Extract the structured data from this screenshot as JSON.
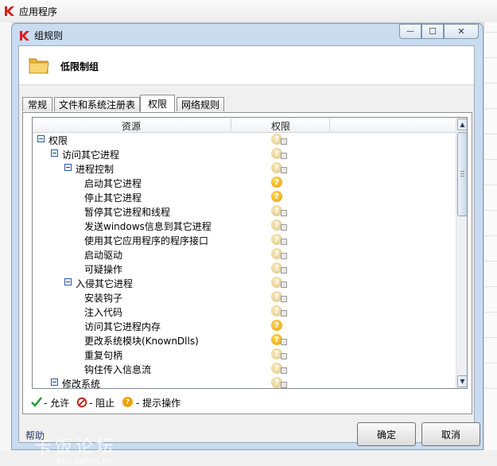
{
  "parent_window": {
    "title": "应用程序"
  },
  "dialog": {
    "title": "组规则",
    "controls": {
      "minimize": "—",
      "maximize": "☐",
      "close": "✕"
    }
  },
  "group": {
    "name": "低限制组"
  },
  "tabs": [
    {
      "label": "常规",
      "active": false
    },
    {
      "label": "文件和系统注册表",
      "active": false
    },
    {
      "label": "权限",
      "active": true
    },
    {
      "label": "网络规则",
      "active": false
    }
  ],
  "tree": {
    "columns": [
      "资源",
      "权限"
    ],
    "rows": [
      {
        "label": "权限",
        "level": 0,
        "expandable": true,
        "perm": "prompt-inherited"
      },
      {
        "label": "访问其它进程",
        "level": 1,
        "expandable": true,
        "perm": "prompt-inherited"
      },
      {
        "label": "进程控制",
        "level": 2,
        "expandable": true,
        "perm": "prompt-inherited"
      },
      {
        "label": "启动其它进程",
        "level": 3,
        "expandable": false,
        "perm": "prompt"
      },
      {
        "label": "停止其它进程",
        "level": 3,
        "expandable": false,
        "perm": "prompt"
      },
      {
        "label": "暂停其它进程和线程",
        "level": 3,
        "expandable": false,
        "perm": "prompt-inherited"
      },
      {
        "label": "发送windows信息到其它进程",
        "level": 3,
        "expandable": false,
        "perm": "prompt-inherited"
      },
      {
        "label": "使用其它应用程序的程序接口",
        "level": 3,
        "expandable": false,
        "perm": "prompt-inherited"
      },
      {
        "label": "启动驱动",
        "level": 3,
        "expandable": false,
        "perm": "prompt-inherited"
      },
      {
        "label": "可疑操作",
        "level": 3,
        "expandable": false,
        "perm": "prompt-inherited"
      },
      {
        "label": "入侵其它进程",
        "level": 2,
        "expandable": true,
        "perm": "prompt-inherited"
      },
      {
        "label": "安装钩子",
        "level": 3,
        "expandable": false,
        "perm": "prompt-inherited"
      },
      {
        "label": "注入代码",
        "level": 3,
        "expandable": false,
        "perm": "prompt-inherited"
      },
      {
        "label": "访问其它进程内存",
        "level": 3,
        "expandable": false,
        "perm": "prompt"
      },
      {
        "label": "更改系统模块(KnownDlls)",
        "level": 3,
        "expandable": false,
        "perm": "prompt-sub"
      },
      {
        "label": "重复句柄",
        "level": 3,
        "expandable": false,
        "perm": "prompt-inherited"
      },
      {
        "label": "钩住传入信息流",
        "level": 3,
        "expandable": false,
        "perm": "prompt-inherited"
      },
      {
        "label": "修改系统",
        "level": 1,
        "expandable": true,
        "perm": "prompt-inherited"
      }
    ]
  },
  "legend": {
    "allow": "- 允许",
    "block": "- 阻止",
    "prompt": "- 提示操作",
    "allow_color": "#1f9a2e",
    "block_color": "#c81414",
    "prompt_color": "#eaa400"
  },
  "footer": {
    "help": "帮助",
    "ok": "确定",
    "cancel": "取消"
  },
  "watermark": {
    "text": "卡饭论坛",
    "url": "bbs.kafan.cn"
  }
}
